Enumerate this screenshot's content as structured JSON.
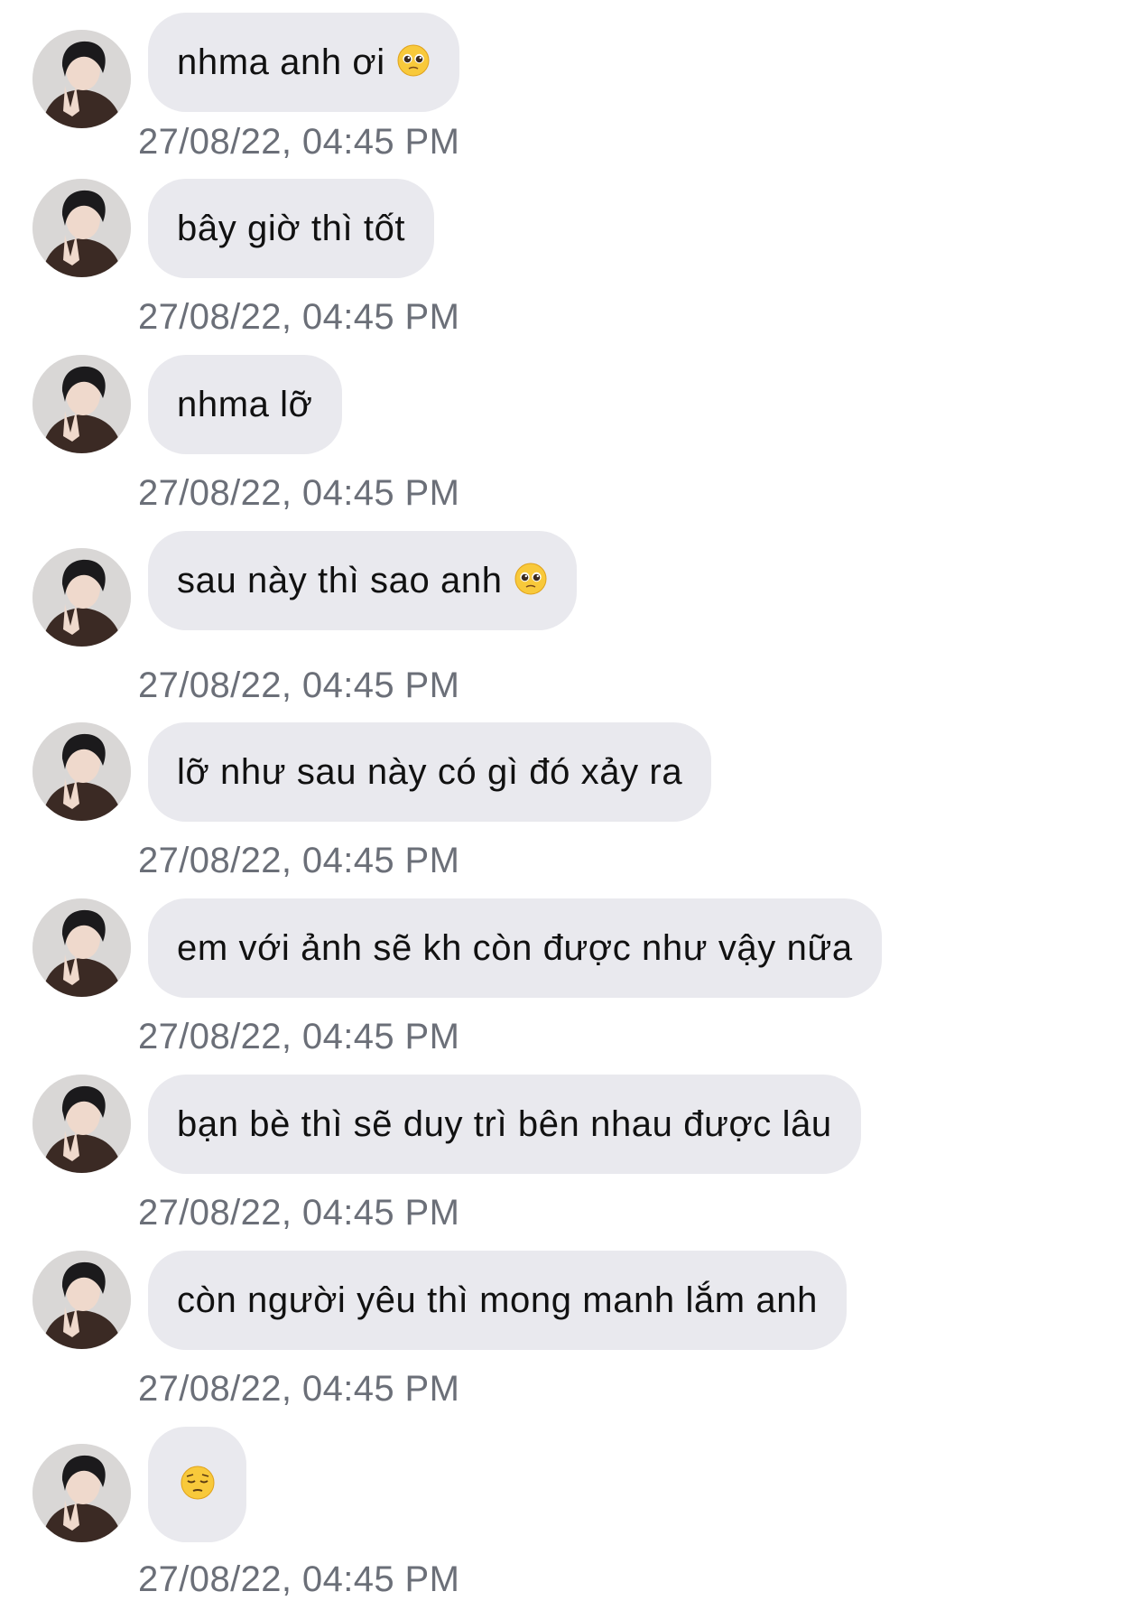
{
  "messages": [
    {
      "text": "nhma anh ơi",
      "emoji": "pleading-face-icon",
      "time": "27/08/22, 04:45 PM"
    },
    {
      "text": "bây giờ thì tốt",
      "emoji": null,
      "time": "27/08/22, 04:45 PM"
    },
    {
      "text": "nhma lỡ",
      "emoji": null,
      "time": "27/08/22, 04:45 PM"
    },
    {
      "text": "sau này thì sao anh",
      "emoji": "pleading-face-icon",
      "time": "27/08/22, 04:45 PM"
    },
    {
      "text": "lỡ như sau này có gì đó xảy ra",
      "emoji": null,
      "time": "27/08/22, 04:45 PM"
    },
    {
      "text": "em với ảnh sẽ kh còn được như vậy nữa",
      "emoji": null,
      "time": "27/08/22, 04:45 PM"
    },
    {
      "text": "bạn bè thì sẽ duy trì bên nhau được lâu",
      "emoji": null,
      "time": "27/08/22, 04:45 PM"
    },
    {
      "text": "còn người yêu thì mong manh lắm anh",
      "emoji": null,
      "time": "27/08/22, 04:45 PM"
    },
    {
      "text": "",
      "emoji": "pensive-face-icon",
      "time": "27/08/22, 04:45 PM"
    }
  ],
  "colors": {
    "bubble": "#e9e9ee",
    "timestamp": "#6b6f78",
    "text": "#111111"
  }
}
